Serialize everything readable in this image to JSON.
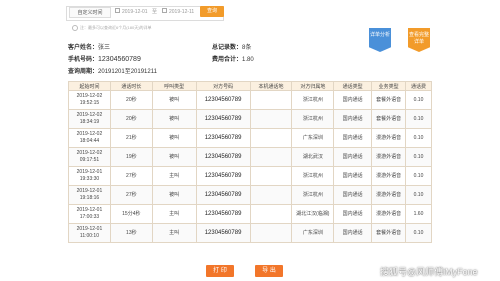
{
  "filter": {
    "mode_label": "自定义时间",
    "start_date": "2019-12-01",
    "separator": "至",
    "end_date": "2019-12-11",
    "query_label": "查询",
    "note": "注：最多可以查询近6个月(180天)的详单"
  },
  "info": {
    "name_label": "客户姓名：",
    "name_value": "张三",
    "phone_label": "手机号码：",
    "phone_value": "12304560789",
    "period_label": "查询周期：",
    "period_value": "20191201至20191211",
    "count_label": "总记录数：",
    "count_value": "8条",
    "fee_label": "费用合计：",
    "fee_value": "1.80"
  },
  "badges": {
    "detail": "详单分析",
    "view": "查看完整详单"
  },
  "table": {
    "headers": [
      "起始时间",
      "通话时长",
      "呼叫类型",
      "对方号码",
      "本机通话地",
      "对方归属地",
      "通话类型",
      "业务类型",
      "通话费"
    ],
    "rows": [
      [
        "2019-12-02",
        "19:52:15",
        "20秒",
        "被叫",
        "12304560789",
        "",
        "浙江杭州",
        "国内通话",
        "套餐外语音",
        "0.10"
      ],
      [
        "2019-12-02",
        "18:34:19",
        "20秒",
        "被叫",
        "12304560789",
        "",
        "浙江杭州",
        "国内通话",
        "套餐外语音",
        "0.10"
      ],
      [
        "2019-12-02",
        "18:04:44",
        "21秒",
        "被叫",
        "12304560789",
        "",
        "广东深圳",
        "国内通话",
        "漫游外语音",
        "0.10"
      ],
      [
        "2019-12-02",
        "09:17:51",
        "19秒",
        "被叫",
        "12304560789",
        "",
        "湖北武汉",
        "国内通话",
        "漫游外语音",
        "0.10"
      ],
      [
        "2019-12-01",
        "19:33:30",
        "27秒",
        "主叫",
        "12304560789",
        "",
        "浙江杭州",
        "国内通话",
        "漫游外语音",
        "0.10"
      ],
      [
        "2019-12-01",
        "19:18:16",
        "27秒",
        "被叫",
        "12304560789",
        "",
        "浙江杭州",
        "国内通话",
        "漫游外语音",
        "0.10"
      ],
      [
        "2019-12-01",
        "17:00:33",
        "15分4秒",
        "主叫",
        "12304560789",
        "",
        "湖北江汉(临湘)",
        "国内通话",
        "漫游外语音",
        "1.60"
      ],
      [
        "2019-12-01",
        "11:00:10",
        "13秒",
        "主叫",
        "12304560789",
        "",
        "广东深圳",
        "国内通话",
        "套餐外语音",
        "0.10"
      ]
    ]
  },
  "actions": {
    "print": "打 印",
    "export": "导 出"
  },
  "watermark": "搜狐号@风师傅iMyFone"
}
